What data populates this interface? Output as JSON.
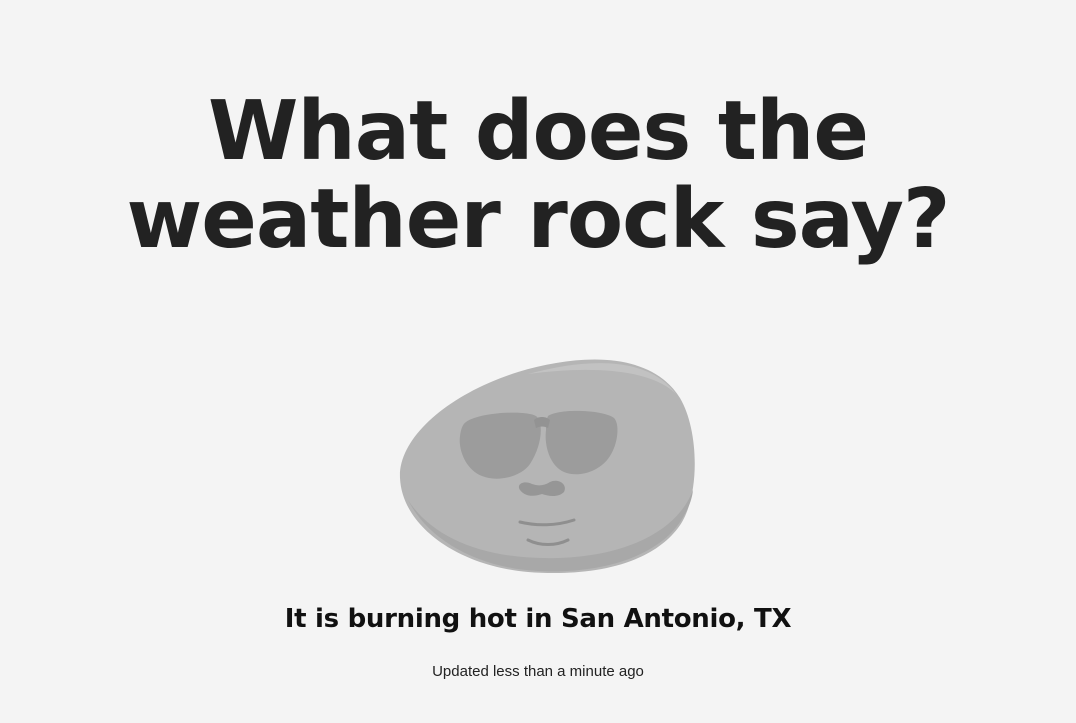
{
  "header": {
    "title_line1": "What does the",
    "title_line2": "weather rock say?"
  },
  "rock": {
    "icon": "rock-with-sunglasses-icon",
    "colors": {
      "body": "#b5b5b5",
      "shadow": "#a6a6a6",
      "sunglasses": "#9a9a9a",
      "features": "#8f8f8f"
    }
  },
  "status": {
    "message": "It is burning hot in San Antonio, TX",
    "updated": "Updated less than a minute ago"
  },
  "colors": {
    "background": "#f4f4f4",
    "text": "#222222"
  }
}
